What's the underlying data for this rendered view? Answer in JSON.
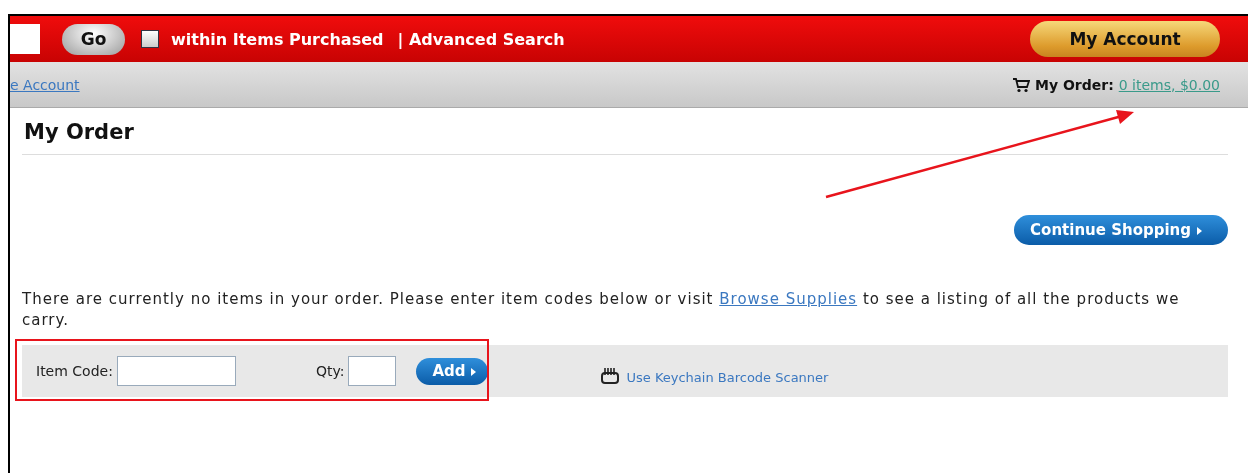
{
  "search": {
    "go_label": "Go",
    "within_checked": false,
    "within_label": "within Items Purchased",
    "advanced_link": "| Advanced Search",
    "account_button": "My Account"
  },
  "subbar": {
    "account_link": "e Account",
    "order_label": "My Order:",
    "order_link": "0 items, $0.00"
  },
  "order": {
    "title": "My Order",
    "continue_button": "Continue Shopping",
    "message_start": "There are currently no items in your order. Please enter item codes below or visit ",
    "message_link": "Browse Supplies",
    "message_end": " to see a listing of all the products we carry."
  },
  "add_form": {
    "item_code_label": "Item Code:",
    "qty_label": "Qty:",
    "add_button": "Add",
    "scanner_link": "Use Keychain Barcode Scanner"
  }
}
